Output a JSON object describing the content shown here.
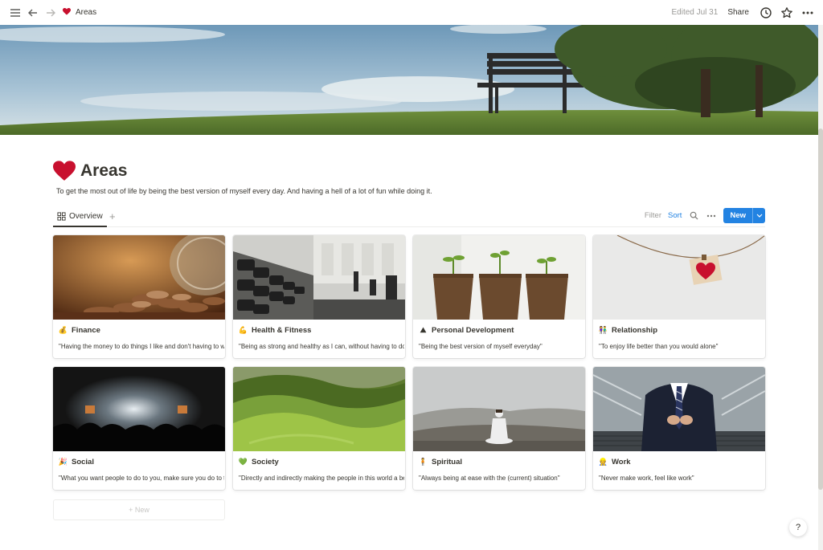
{
  "topbar": {
    "breadcrumb": "Areas",
    "edited": "Edited Jul 31",
    "share": "Share"
  },
  "page": {
    "title": "Areas",
    "description": "To get the most out of life by being the best version of myself every day. And having a hell of a lot of fun while doing it."
  },
  "view": {
    "tab": "Overview",
    "filter": "Filter",
    "sort": "Sort",
    "new": "New"
  },
  "cards": [
    {
      "title": "Finance",
      "icon": "coins-icon",
      "desc": "\"Having the money to do things I like and don't having to worry\""
    },
    {
      "title": "Health & Fitness",
      "icon": "flexed-arm-icon",
      "desc": "\"Being as strong and healthy as I can, without having to do crazy things\""
    },
    {
      "title": "Personal Development",
      "icon": "mountain-icon",
      "desc": "\"Being the best version of myself everyday\""
    },
    {
      "title": "Relationship",
      "icon": "couple-icon",
      "desc": "\"To enjoy life better than you would alone\""
    },
    {
      "title": "Social",
      "icon": "party-popper-icon",
      "desc": "\"What you want people to do to you, make sure you do to them\""
    },
    {
      "title": "Society",
      "icon": "green-heart-icon",
      "desc": "\"Directly and indirectly making the people in this world a better place\""
    },
    {
      "title": "Spiritual",
      "icon": "person-standing-icon",
      "desc": "\"Always being at ease with the (current) situation\""
    },
    {
      "title": "Work",
      "icon": "worker-icon",
      "desc": "\"Never make work, feel like work\""
    }
  ],
  "new_card": "+ New",
  "help": "?",
  "colors": {
    "accent": "#2383e2",
    "heart": "#c8102e",
    "text": "#37352f"
  }
}
